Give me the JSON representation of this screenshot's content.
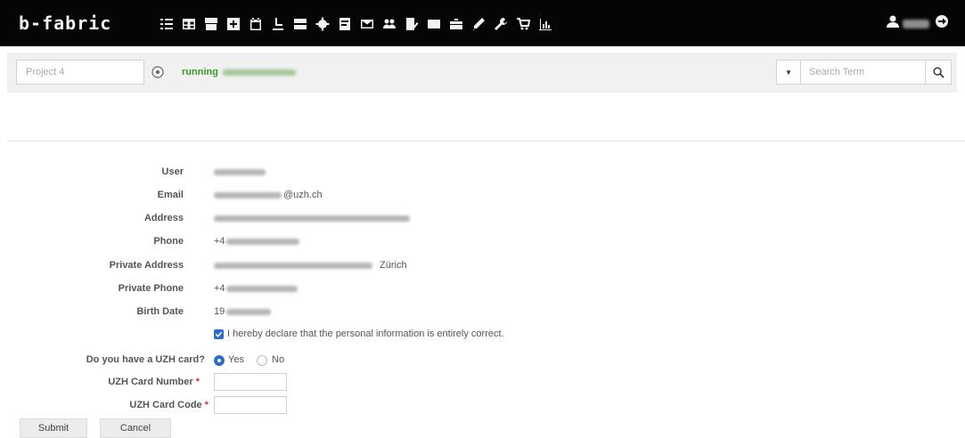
{
  "navbar": {
    "brand": "b-fabric",
    "icons": [
      "list-icon",
      "table-icon",
      "archive-icon",
      "plus-square-icon",
      "calendar-icon",
      "flask-icon",
      "drive-icon",
      "gear-icon",
      "file-icon",
      "envelope-icon",
      "users-icon",
      "file-edit-icon",
      "sample-icon",
      "toolbox-icon",
      "pencil-icon",
      "wrench-icon",
      "cart-icon",
      "chart-icon"
    ],
    "user_icon": "user-icon",
    "logout_icon": "logout-icon"
  },
  "subbar": {
    "project_placeholder": "Project 4",
    "status": "running",
    "search_placeholder": "Search Term"
  },
  "form": {
    "labels": {
      "user": "User",
      "email": "Email",
      "address": "Address",
      "phone": "Phone",
      "private_address": "Private Address",
      "private_phone": "Private Phone",
      "birth_date": "Birth Date"
    },
    "email_domain": "@uzh.ch",
    "phone_prefix": "+4",
    "private_phone_prefix": "+4",
    "private_address_suffix": "Zürich",
    "birth_prefix": "19",
    "declaration": "I hereby declare that the personal information is entirely correct.",
    "uzh_card_question": "Do you have a UZH card?",
    "yes": "Yes",
    "no": "No",
    "card_number_label": "UZH Card Number",
    "card_code_label": "UZH Card Code",
    "required_mark": "*"
  },
  "buttons": {
    "submit": "Submit",
    "cancel": "Cancel"
  }
}
